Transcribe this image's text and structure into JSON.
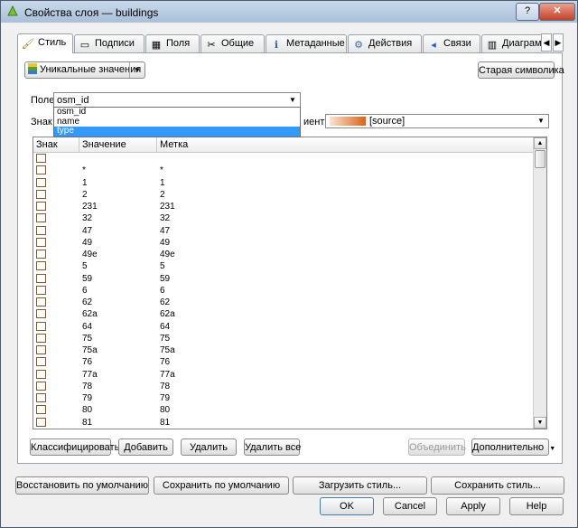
{
  "window": {
    "title": "Свойства слоя — buildings",
    "help_btn": "?",
    "close_btn": "✕"
  },
  "tabs": [
    {
      "label": "Стиль",
      "icon": "paintbrush-icon",
      "glyph": "🖌"
    },
    {
      "label": "Подписи",
      "icon": "label-icon",
      "glyph": "▭"
    },
    {
      "label": "Поля",
      "icon": "table-icon",
      "glyph": "▦"
    },
    {
      "label": "Общие",
      "icon": "tools-icon",
      "glyph": "✂"
    },
    {
      "label": "Метаданные",
      "icon": "info-icon",
      "glyph": "ℹ"
    },
    {
      "label": "Действия",
      "icon": "gear-icon",
      "glyph": "⚙"
    },
    {
      "label": "Связи",
      "icon": "join-icon",
      "glyph": "◂"
    },
    {
      "label": "Диаграм",
      "icon": "diagram-icon",
      "glyph": "▥"
    }
  ],
  "style": {
    "renderer_label": "Уникальные значения",
    "old_symbology": "Старая символика",
    "field_label": "Поле",
    "field_value": "osm_id",
    "field_options": [
      "osm_id",
      "name",
      "type"
    ],
    "field_selected_index": 2,
    "symbol_label": "Знак",
    "ramp_label": "иент",
    "ramp_value": "[source]"
  },
  "table": {
    "headers": [
      "Знак",
      "Значение",
      "Метка"
    ],
    "rows": [
      {
        "value": "",
        "label": ""
      },
      {
        "value": "*",
        "label": "*"
      },
      {
        "value": "1",
        "label": "1"
      },
      {
        "value": "2",
        "label": "2"
      },
      {
        "value": "231",
        "label": "231"
      },
      {
        "value": "32",
        "label": "32"
      },
      {
        "value": "47",
        "label": "47"
      },
      {
        "value": "49",
        "label": "49"
      },
      {
        "value": "49e",
        "label": "49e"
      },
      {
        "value": "5",
        "label": "5"
      },
      {
        "value": "59",
        "label": "59"
      },
      {
        "value": "6",
        "label": "6"
      },
      {
        "value": "62",
        "label": "62"
      },
      {
        "value": "62a",
        "label": "62a"
      },
      {
        "value": "64",
        "label": "64"
      },
      {
        "value": "75",
        "label": "75"
      },
      {
        "value": "75a",
        "label": "75a"
      },
      {
        "value": "76",
        "label": "76"
      },
      {
        "value": "77a",
        "label": "77a"
      },
      {
        "value": "78",
        "label": "78"
      },
      {
        "value": "79",
        "label": "79"
      },
      {
        "value": "80",
        "label": "80"
      },
      {
        "value": "81",
        "label": "81"
      },
      {
        "value": "",
        "label": ""
      }
    ]
  },
  "actions": {
    "classify": "Классифицировать",
    "add": "Добавить",
    "delete": "Удалить",
    "delete_all": "Удалить все",
    "merge": "Объединить",
    "more": "Дополнительно"
  },
  "style_buttons": {
    "restore_default": "Восстановить по умолчанию",
    "save_default": "Сохранить по умолчанию",
    "load_style": "Загрузить стиль...",
    "save_style": "Сохранить стиль..."
  },
  "dialog": {
    "ok": "OK",
    "cancel": "Cancel",
    "apply": "Apply",
    "help": "Help"
  }
}
